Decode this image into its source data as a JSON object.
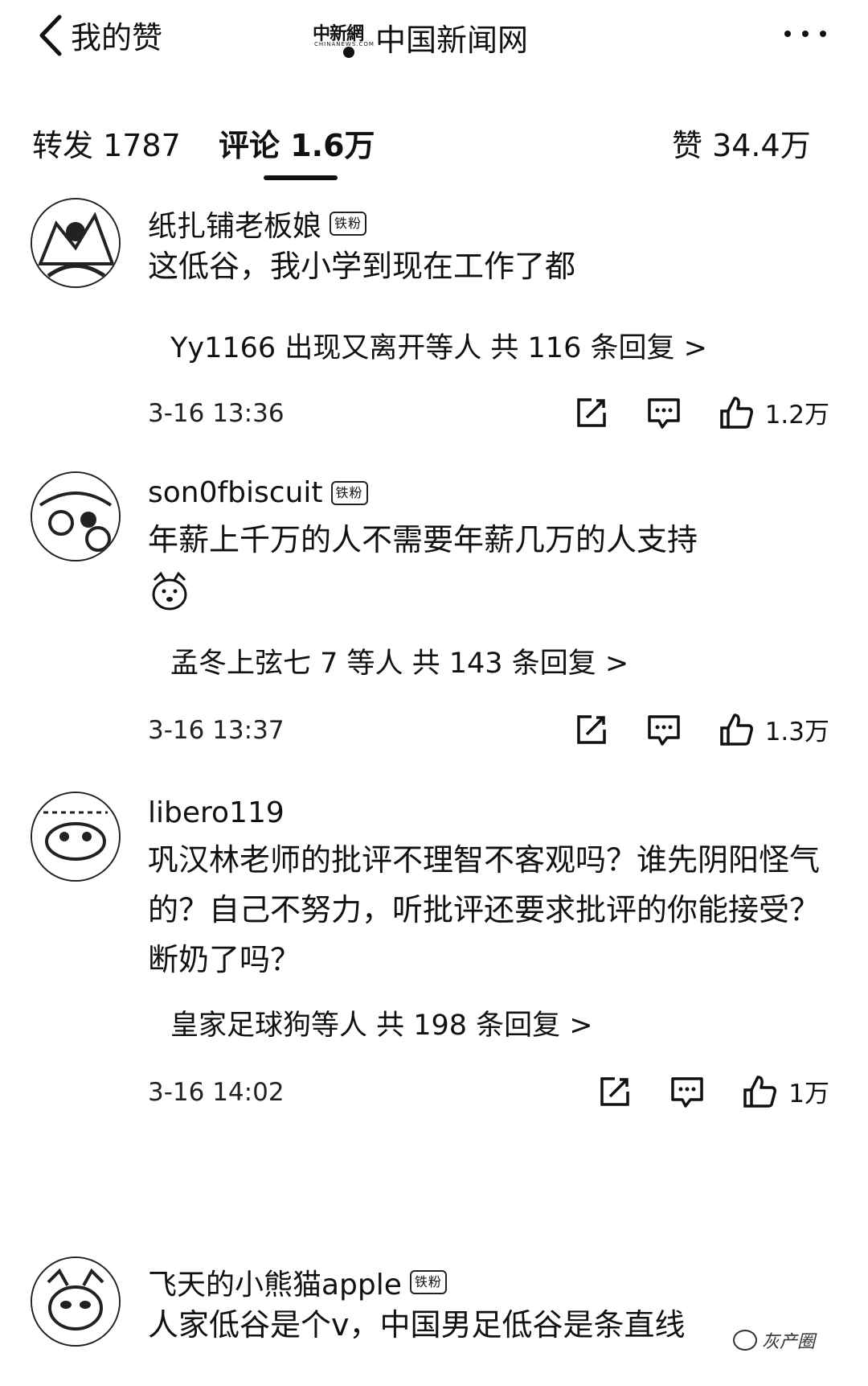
{
  "topbar": {
    "back_label": "我的赞",
    "logo_text": "中新網",
    "logo_sub": "CHINANEWS.COM",
    "source_name": "中国新闻网"
  },
  "tabs": {
    "repost": "转发 1787",
    "comments": "评论 1.6万",
    "likes": "赞 34.4万"
  },
  "comments": [
    {
      "username": "纸扎铺老板娘",
      "badge": "铁粉",
      "text": "这低谷，我小学到现在工作了都",
      "replies": "Yy1166 出现又离开等人  共 116 条回复 >",
      "time": "3-16 13:36",
      "likes": "1.2万"
    },
    {
      "username": "son0fbiscuit",
      "badge": "铁粉",
      "text": "年薪上千万的人不需要年薪几万的人支持",
      "emoji": "doge-emoji",
      "replies": "孟冬上弦七 7 等人  共 143 条回复 >",
      "time": "3-16 13:37",
      "likes": "1.3万"
    },
    {
      "username": "libero119",
      "badge": "",
      "text": "巩汉林老师的批评不理智不客观吗？谁先阴阳怪气的？自己不努力，听批评还要求批评的你能接受？断奶了吗？",
      "replies": "皇家足球狗等人  共 198 条回复 >",
      "time": "3-16 14:02",
      "likes": "1万"
    },
    {
      "username": "飞天的小熊猫apple",
      "badge": "铁粉",
      "text": "人家低谷是个v，中国男足低谷是条直线"
    }
  ],
  "watermark": "灰产圈",
  "icons": {
    "back": "chevron-left-icon",
    "more": "more-dots-icon",
    "repost": "edit-share-icon",
    "reply": "comment-bubble-icon",
    "like": "thumbs-up-icon"
  }
}
